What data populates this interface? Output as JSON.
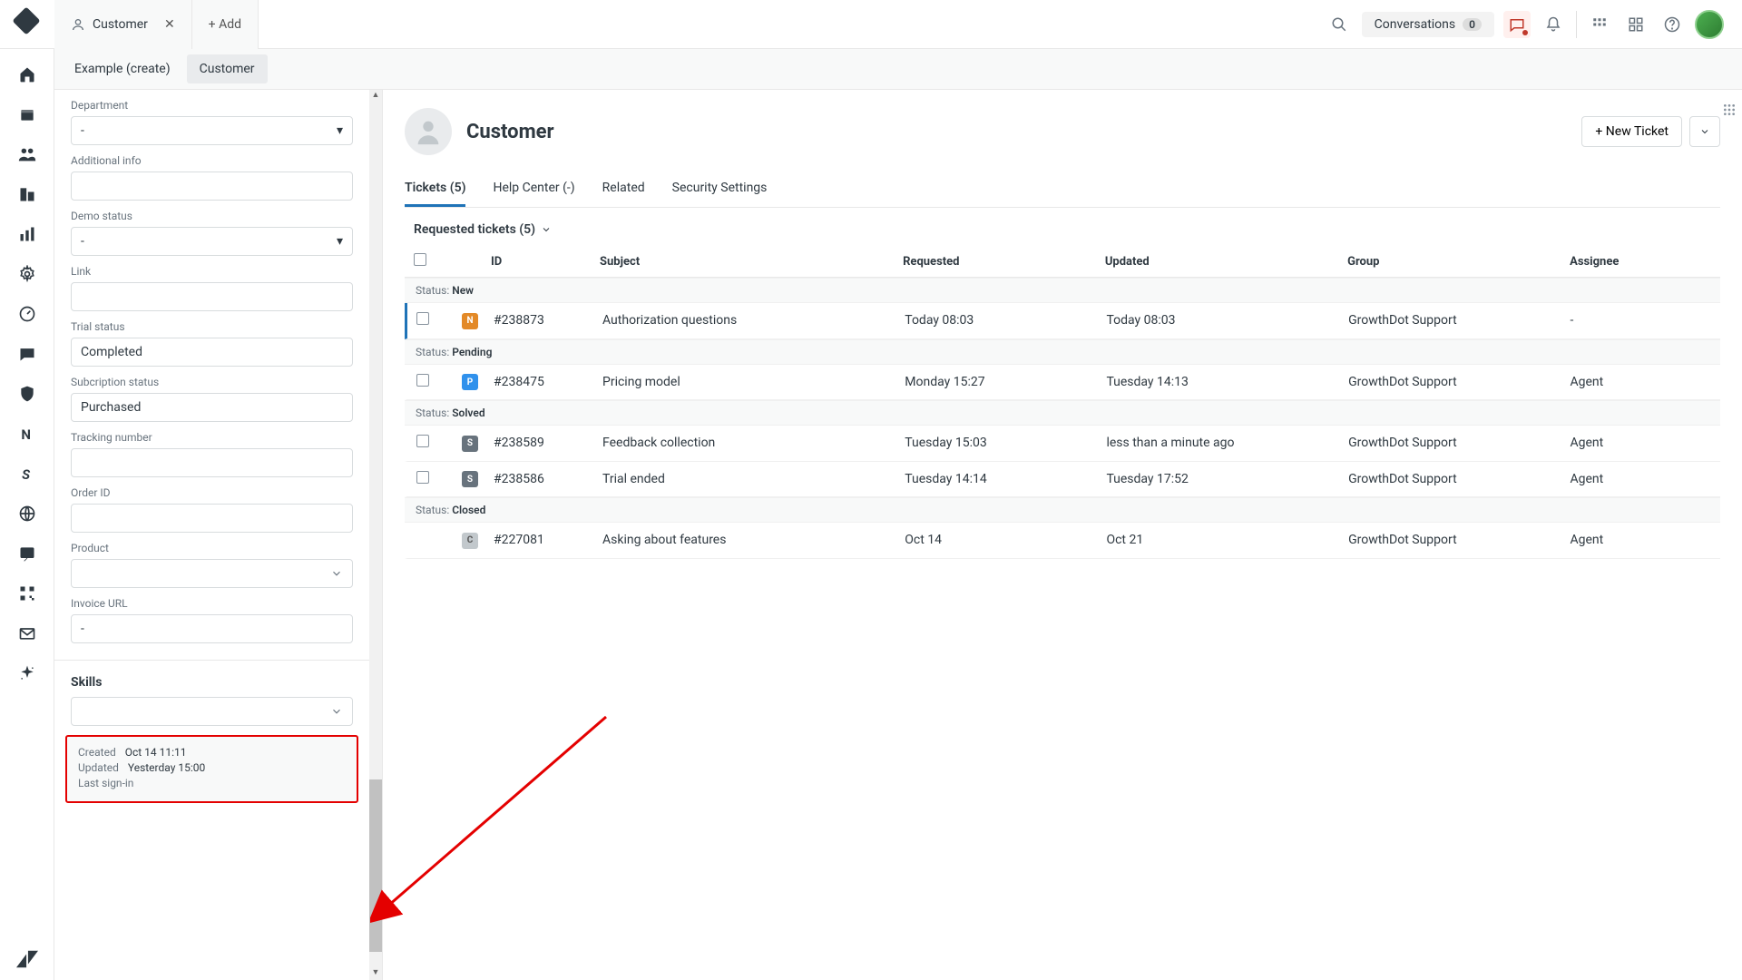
{
  "header": {
    "tab_title": "Customer",
    "add_label": "+ Add",
    "conversations_label": "Conversations",
    "conversations_count": "0"
  },
  "subheader": {
    "tab1": "Example (create)",
    "tab2": "Customer"
  },
  "side": {
    "department_label": "Department",
    "department_value": "-",
    "additional_label": "Additional info",
    "additional_value": "",
    "demo_label": "Demo status",
    "demo_value": "-",
    "link_label": "Link",
    "link_value": "",
    "trial_label": "Trial status",
    "trial_value": "Completed",
    "sub_label": "Subcription status",
    "sub_value": "Purchased",
    "track_label": "Tracking number",
    "track_value": "",
    "order_label": "Order ID",
    "order_value": "",
    "product_label": "Product",
    "invoice_label": "Invoice URL",
    "invoice_value": "-",
    "skills_title": "Skills",
    "meta_created_label": "Created",
    "meta_created_value": "Oct 14 11:11",
    "meta_updated_label": "Updated",
    "meta_updated_value": "Yesterday 15:00",
    "meta_signin_label": "Last sign-in",
    "meta_signin_value": ""
  },
  "main": {
    "title": "Customer",
    "new_ticket": "+ New Ticket",
    "tabs": {
      "tickets": "Tickets (5)",
      "help": "Help Center (-)",
      "related": "Related",
      "security": "Security Settings"
    },
    "requested_header": "Requested tickets (5)",
    "columns": {
      "id": "ID",
      "subject": "Subject",
      "requested": "Requested",
      "updated": "Updated",
      "group": "Group",
      "assignee": "Assignee"
    },
    "status_prefix": "Status: ",
    "groups": [
      {
        "status": "New",
        "rows": [
          {
            "badge": "N",
            "id": "#238873",
            "subject": "Authorization questions",
            "requested": "Today 08:03",
            "updated": "Today 08:03",
            "group": "GrowthDot Support",
            "assignee": "-",
            "accent": true
          }
        ]
      },
      {
        "status": "Pending",
        "rows": [
          {
            "badge": "P",
            "id": "#238475",
            "subject": "Pricing model",
            "requested": "Monday 15:27",
            "updated": "Tuesday 14:13",
            "group": "GrowthDot Support",
            "assignee": "Agent"
          }
        ]
      },
      {
        "status": "Solved",
        "rows": [
          {
            "badge": "S",
            "id": "#238589",
            "subject": "Feedback collection",
            "requested": "Tuesday 15:03",
            "updated": "less than a minute ago",
            "group": "GrowthDot Support",
            "assignee": "Agent"
          },
          {
            "badge": "S",
            "id": "#238586",
            "subject": "Trial ended",
            "requested": "Tuesday 14:14",
            "updated": "Tuesday 17:52",
            "group": "GrowthDot Support",
            "assignee": "Agent"
          }
        ]
      },
      {
        "status": "Closed",
        "rows": [
          {
            "badge": "C",
            "id": "#227081",
            "subject": "Asking about features",
            "requested": "Oct 14",
            "updated": "Oct 21",
            "group": "GrowthDot Support",
            "assignee": "Agent",
            "nocheck": true
          }
        ]
      }
    ]
  }
}
